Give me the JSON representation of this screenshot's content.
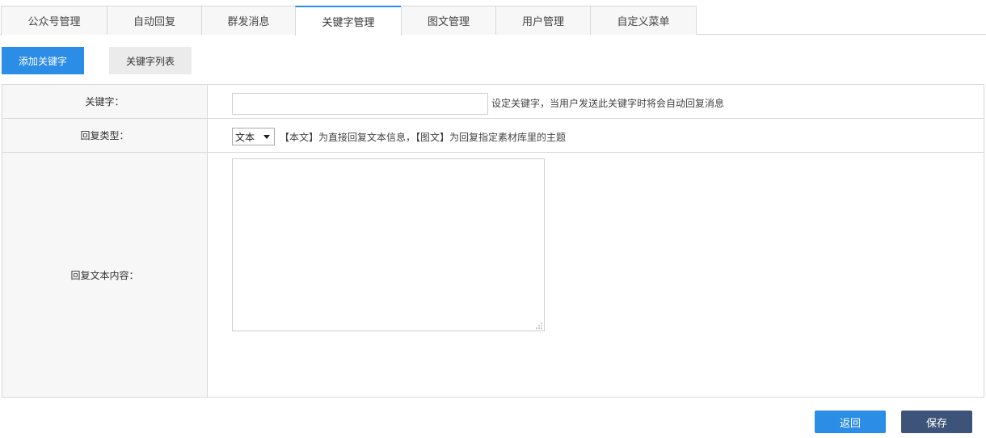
{
  "tabs": [
    {
      "label": "公众号管理",
      "active": false
    },
    {
      "label": "自动回复",
      "active": false
    },
    {
      "label": "群发消息",
      "active": false
    },
    {
      "label": "关键字管理",
      "active": true
    },
    {
      "label": "图文管理",
      "active": false
    },
    {
      "label": "用户管理",
      "active": false
    },
    {
      "label": "自定义菜单",
      "active": false
    }
  ],
  "subnav": {
    "add_label": "添加关键字",
    "list_label": "关键字列表"
  },
  "form": {
    "keyword": {
      "label": "关键字：",
      "value": "",
      "hint": "设定关键字，当用户发送此关键字时将会自动回复消息"
    },
    "reply_type": {
      "label": "回复类型：",
      "selected": "文本",
      "hint": "【本文】为直接回复文本信息，【图文】为回复指定素材库里的主题"
    },
    "reply_text": {
      "label": "回复文本内容：",
      "value": ""
    }
  },
  "actions": {
    "back_label": "返回",
    "save_label": "保存"
  },
  "colors": {
    "primary": "#2b8de6",
    "save": "#3e5379",
    "border": "#d9d9d9",
    "label_bg": "#f7f7f7"
  }
}
